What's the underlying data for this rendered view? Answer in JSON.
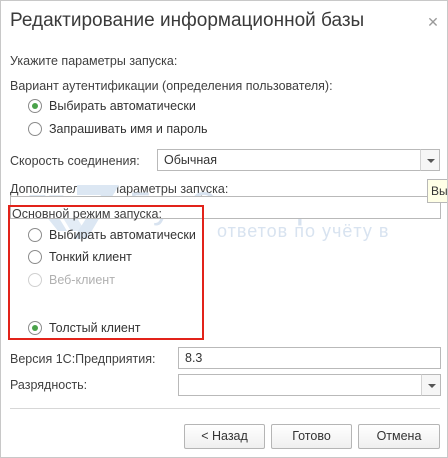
{
  "window": {
    "title": "Редактирование информационной базы"
  },
  "launch_params_label": "Укажите параметры запуска:",
  "auth": {
    "label": "Вариант аутентификации (определения пользователя):",
    "options": [
      {
        "label": "Выбирать автоматически",
        "checked": true
      },
      {
        "label": "Запрашивать имя и пароль",
        "checked": false
      }
    ]
  },
  "connection_speed": {
    "label": "Скорость соединения:",
    "value": "Обычная"
  },
  "extra_params": {
    "label": "Дополнительные параметры запуска:",
    "value": ""
  },
  "tooltip": {
    "text": "Вы"
  },
  "watermark": {
    "main": "БухЭксперт",
    "sub": "ответов по учёту в"
  },
  "launch_mode": {
    "label": "Основной режим запуска:",
    "options": [
      {
        "label": "Выбирать автоматически",
        "checked": false,
        "disabled": false
      },
      {
        "label": "Тонкий клиент",
        "checked": false,
        "disabled": false
      },
      {
        "label": "Веб-клиент",
        "checked": false,
        "disabled": true
      },
      {
        "label": "Толстый клиент",
        "checked": true,
        "disabled": false
      }
    ]
  },
  "version": {
    "label": "Версия 1С:Предприятия:",
    "value": "8.3"
  },
  "bitness": {
    "label": "Разрядность:",
    "value": ""
  },
  "buttons": {
    "back": "< Назад",
    "done": "Готово",
    "cancel": "Отмена"
  },
  "colors": {
    "highlight": "#e2231a",
    "radio_selected": "#4aa24a"
  }
}
